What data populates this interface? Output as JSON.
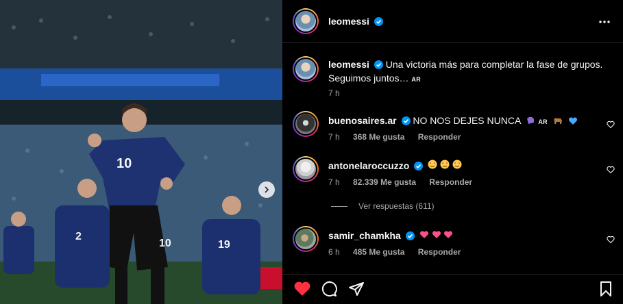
{
  "post": {
    "username": "leomessi",
    "caption_line1": "Una victoria más para completar la fase de grupos.",
    "caption_line2": "Seguimos juntos…",
    "caption_badge": "AR",
    "time": "7 h"
  },
  "comments": [
    {
      "username": "buenosaires.ar",
      "text": "NO NOS DEJES NUNCA",
      "badge": "AR",
      "time": "7 h",
      "likes": "368 Me gusta",
      "reply": "Responder"
    },
    {
      "username": "antonelaroccuzzo",
      "text": "",
      "time": "7 h",
      "likes": "82.339 Me gusta",
      "reply": "Responder",
      "replies_label": "Ver respuestas (611)"
    },
    {
      "username": "samir_chamkha",
      "text": "",
      "time": "6 h",
      "likes": "485 Me gusta",
      "reply": "Responder"
    }
  ],
  "icons": {
    "more": "more-horizontal-icon",
    "verified": "verified-badge-icon",
    "like": "heart-icon",
    "comment": "comment-bubble-icon",
    "share": "send-icon",
    "save": "bookmark-icon",
    "next": "chevron-right-icon"
  },
  "colors": {
    "background": "#000000",
    "verified": "#0095f6",
    "liked": "#ff3040",
    "muted_text": "#a8a8a8"
  }
}
